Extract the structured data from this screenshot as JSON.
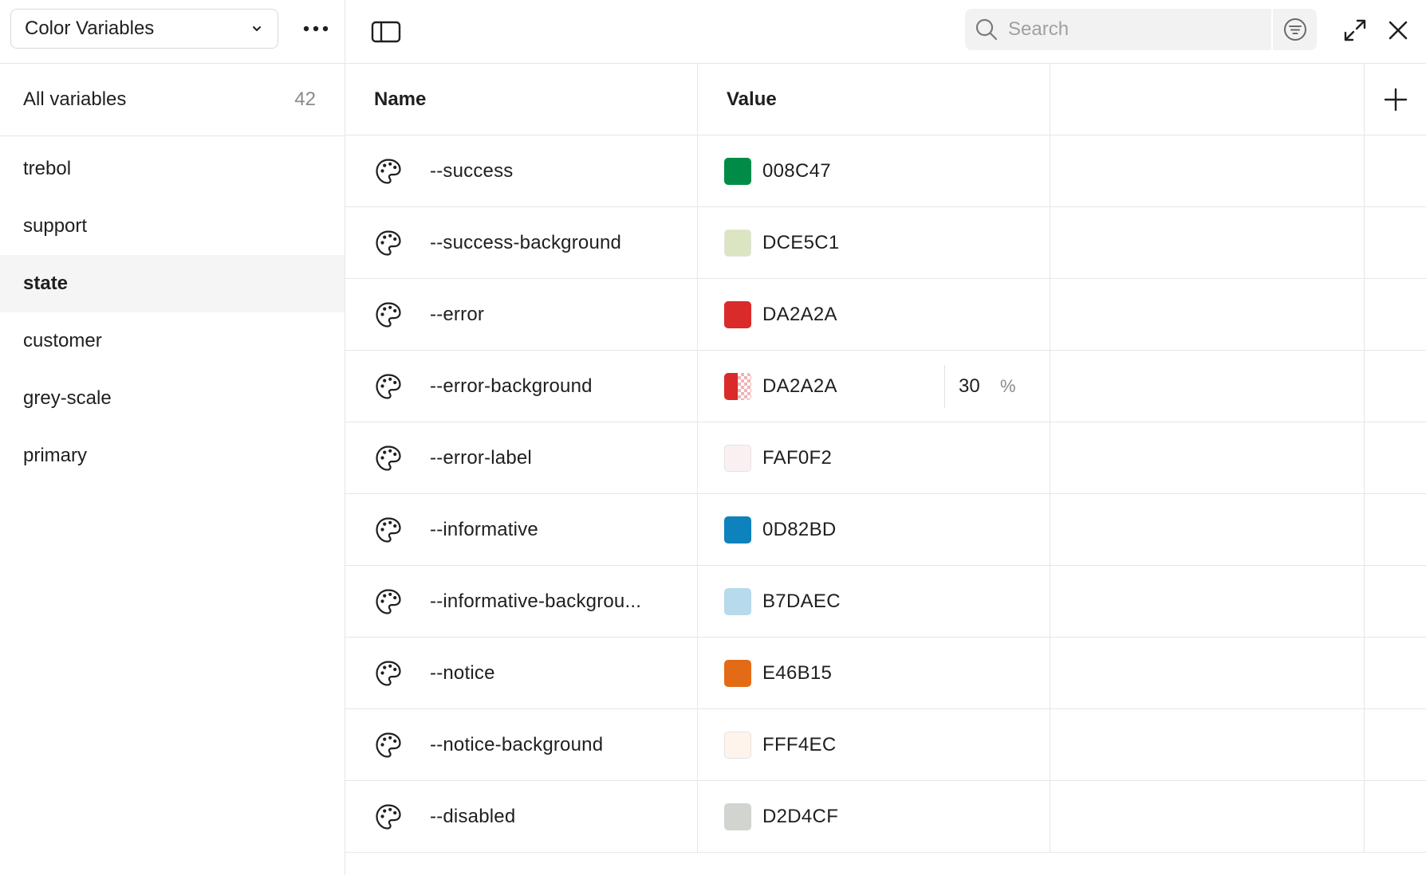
{
  "sidebar": {
    "collection_label": "Color Variables",
    "all_variables": {
      "label": "All variables",
      "count": "42"
    },
    "groups": [
      {
        "label": "trebol"
      },
      {
        "label": "support"
      },
      {
        "label": "state",
        "active": true
      },
      {
        "label": "customer"
      },
      {
        "label": "grey-scale"
      },
      {
        "label": "primary"
      }
    ]
  },
  "toolbar": {
    "search_placeholder": "Search"
  },
  "table": {
    "headers": {
      "name": "Name",
      "value": "Value"
    },
    "rows": [
      {
        "name": "--success",
        "hex": "008C47",
        "color": "#008C47"
      },
      {
        "name": "--success-background",
        "hex": "DCE5C1",
        "color": "#DCE5C1"
      },
      {
        "name": "--error",
        "hex": "DA2A2A",
        "color": "#DA2A2A"
      },
      {
        "name": "--error-background",
        "hex": "DA2A2A",
        "color": "#DA2A2A",
        "alpha": "30",
        "alpha_unit": "%"
      },
      {
        "name": "--error-label",
        "hex": "FAF0F2",
        "color": "#FAF0F2"
      },
      {
        "name": "--informative",
        "hex": "0D82BD",
        "color": "#0D82BD"
      },
      {
        "name": "--informative-backgrou...",
        "hex": "B7DAEC",
        "color": "#B7DAEC"
      },
      {
        "name": "--notice",
        "hex": "E46B15",
        "color": "#E46B15"
      },
      {
        "name": "--notice-background",
        "hex": "FFF4EC",
        "color": "#FFF4EC"
      },
      {
        "name": "--disabled",
        "hex": "D2D4CF",
        "color": "#D2D4CF"
      }
    ]
  },
  "icons": {
    "collection_chevron": "chevron-down-icon",
    "more": "more-horizontal-icon",
    "panel": "sidebar-panel-icon",
    "search": "search-icon",
    "filter": "filter-icon",
    "expand": "expand-icon",
    "close": "close-icon",
    "add": "plus-icon",
    "variable": "palette-icon"
  }
}
